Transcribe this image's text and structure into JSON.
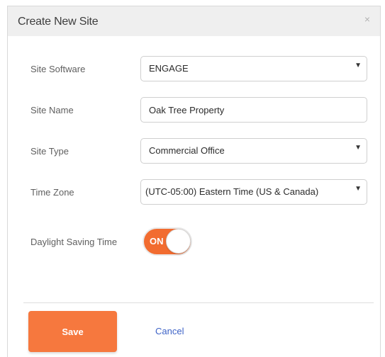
{
  "dialog": {
    "title": "Create New Site",
    "close_label": "×"
  },
  "form": {
    "site_software": {
      "label": "Site Software",
      "value": "ENGAGE"
    },
    "site_name": {
      "label": "Site Name",
      "value": "Oak Tree Property"
    },
    "site_type": {
      "label": "Site Type",
      "value": "Commercial Office"
    },
    "time_zone": {
      "label": "Time Zone",
      "value": "(UTC-05:00) Eastern Time (US & Canada)"
    },
    "daylight_saving": {
      "label": "Daylight Saving Time",
      "state_label": "ON"
    }
  },
  "actions": {
    "save_label": "Save",
    "cancel_label": "Cancel"
  },
  "colors": {
    "accent": "#f6783e",
    "link": "#3e63c7",
    "header_bg": "#efefef"
  },
  "icons": {
    "close": "close-icon",
    "dropdown": "caret-down-icon"
  }
}
